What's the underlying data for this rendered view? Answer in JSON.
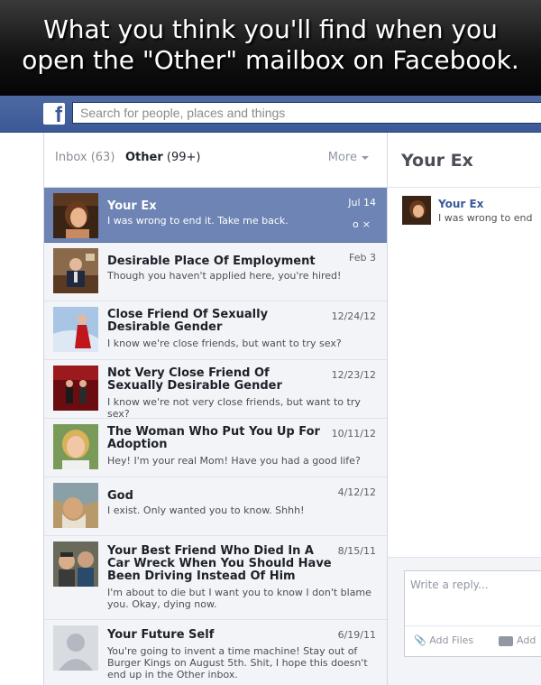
{
  "caption": {
    "line1": "What you think you'll find when you",
    "line2": "open the \"Other\" mailbox on Facebook."
  },
  "header": {
    "logo": "f",
    "search_placeholder": "Search for people, places and things",
    "brand_color": "#3b5998"
  },
  "tabs": {
    "inbox_label": "Inbox",
    "inbox_count": "(63)",
    "other_label": "Other",
    "other_count": "(99+)",
    "more_label": "More"
  },
  "messages": [
    {
      "sender": "Your Ex",
      "preview": "I was wrong to end it. Take me back.",
      "date": "Jul 14",
      "selected": true,
      "thumb": "woman-portrait"
    },
    {
      "sender": "Desirable Place Of Employment",
      "preview": "Though you haven't applied here, you're hired!",
      "date": "Feb 3",
      "thumb": "office-man"
    },
    {
      "sender": "Close Friend Of Sexually Desirable Gender",
      "preview": "I know we're close friends, but want to try sex?",
      "date": "12/24/12",
      "thumb": "woman-red-dress"
    },
    {
      "sender": "Not Very Close Friend Of Sexually Desirable Gender",
      "preview": "I know we're not very close friends, but want to try sex?",
      "date": "12/23/12",
      "thumb": "red-stage"
    },
    {
      "sender": "The Woman Who Put You Up For Adoption",
      "preview": "Hey! I'm your real Mom! Have you had a good life?",
      "date": "10/11/12",
      "thumb": "blonde-woman"
    },
    {
      "sender": "God",
      "preview": "I exist. Only wanted you to know. Shhh!",
      "date": "4/12/12",
      "thumb": "painting-god"
    },
    {
      "sender": "Your Best Friend Who Died In A Car Wreck When You Should Have Been Driving Instead Of Him",
      "preview": "I'm about to die but I want you to know I don't blame you. Okay, dying now.",
      "date": "8/15/11",
      "thumb": "two-men"
    },
    {
      "sender": "Your Future Self",
      "preview": "You're going to invent a time machine! Stay out of Burger Kings on August 5th. Shit, I hope this doesn't end up in the Other inbox.",
      "date": "6/19/11",
      "thumb": "silhouette"
    }
  ],
  "conversation": {
    "title": "Your Ex",
    "name": "Your Ex",
    "snippet": "I was wrong to end",
    "reply_placeholder": "Write a reply...",
    "add_files": "Add Files",
    "add_photos": "Add"
  }
}
